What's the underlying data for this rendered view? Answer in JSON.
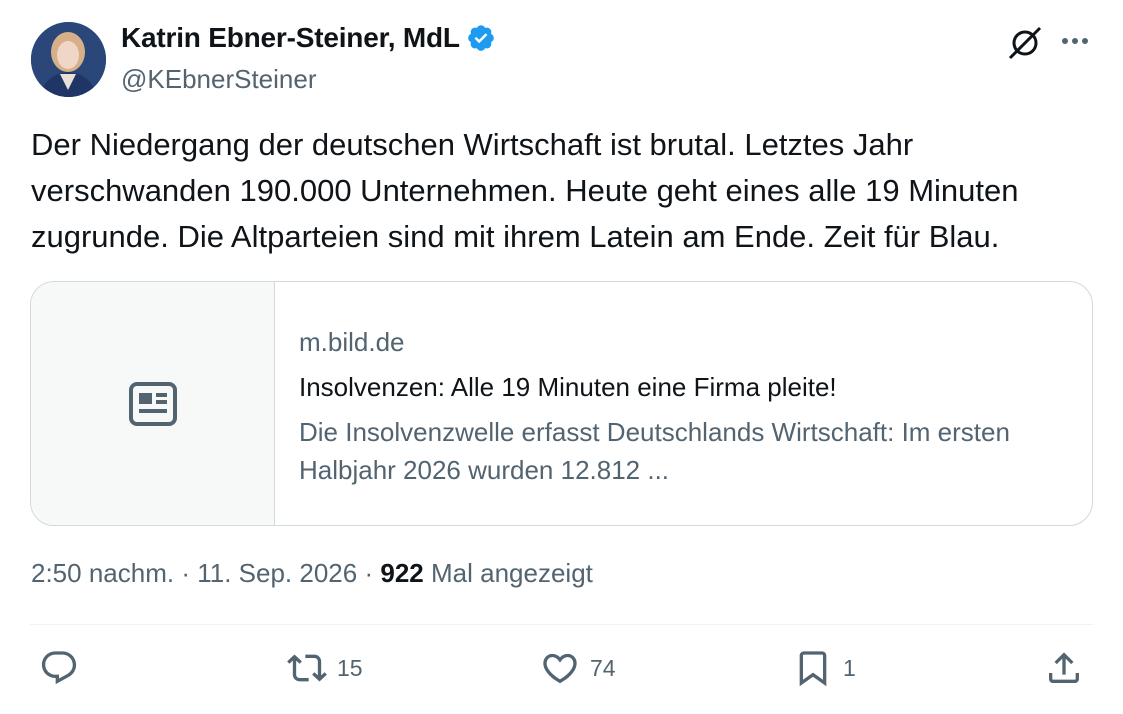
{
  "author": {
    "display_name": "Katrin Ebner-Steiner, MdL",
    "handle": "@KEbnerSteiner",
    "verified": true
  },
  "tweet": {
    "text": "Der Niedergang der deutschen Wirtschaft ist brutal. Letztes Jahr verschwanden 190.000 Unternehmen. Heute geht eines alle 19 Minuten zugrunde. Die Altparteien sind mit ihrem Latein am Ende. Zeit für Blau."
  },
  "link_card": {
    "domain": "m.bild.de",
    "title": "Insolvenzen: Alle 19 Minuten eine Firma pleite!",
    "description": "Die Insolvenzwelle erfasst Deutschlands Wirtschaft: Im ersten Halbjahr 2026 wurden 12.812 ..."
  },
  "meta": {
    "time": "2:50 nachm.",
    "separator": "·",
    "date": "11. Sep. 2026",
    "views_count": "922",
    "views_label": "Mal angezeigt"
  },
  "actions": {
    "reply_count": "",
    "retweet_count": "15",
    "like_count": "74",
    "bookmark_count": "1"
  },
  "icons": {
    "verified": "verified-badge-icon",
    "grok": "grok-icon",
    "more": "more-icon",
    "card_placeholder": "article-icon",
    "reply": "reply-icon",
    "retweet": "retweet-icon",
    "like": "heart-icon",
    "bookmark": "bookmark-icon",
    "share": "share-icon"
  },
  "colors": {
    "verified_blue": "#1d9bf0",
    "text_primary": "#0f1419",
    "text_secondary": "#536471",
    "border": "#cfd9de"
  }
}
